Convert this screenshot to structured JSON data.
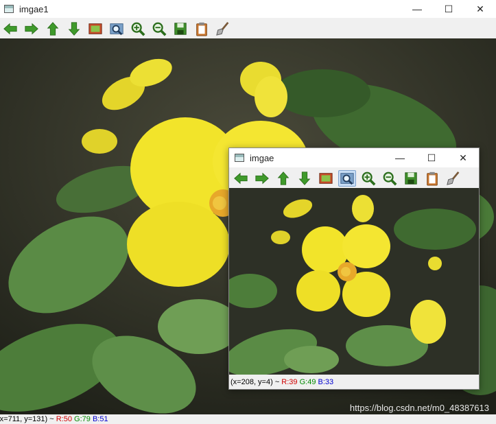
{
  "main_window": {
    "title": "imgae1",
    "status": {
      "coords": "(x=711, y=131) ~ ",
      "r": "R:50",
      "g": "G:79",
      "b": "B:51"
    }
  },
  "sub_window": {
    "title": "imgae",
    "status": {
      "coords": "(x=208, y=4) ~ ",
      "r": "R:39",
      "g": "G:49",
      "b": "B:33"
    }
  },
  "toolbar_icons": [
    "arrow-left-icon",
    "arrow-right-icon",
    "arrow-up-icon",
    "arrow-down-icon",
    "fit-image-icon",
    "zoom-rect-icon",
    "zoom-in-icon",
    "zoom-out-icon",
    "save-icon",
    "clipboard-icon",
    "brush-icon"
  ],
  "window_controls": {
    "minimize": "—",
    "maximize": "☐",
    "close": "✕"
  },
  "watermark": "https://blog.csdn.net/m0_48387613",
  "colors": {
    "petal": "#f2e42a",
    "leaf": "#4f7a3c",
    "soil": "#3b3a30",
    "accent_r": "#d00000",
    "accent_g": "#008a00",
    "accent_b": "#0000d0"
  }
}
